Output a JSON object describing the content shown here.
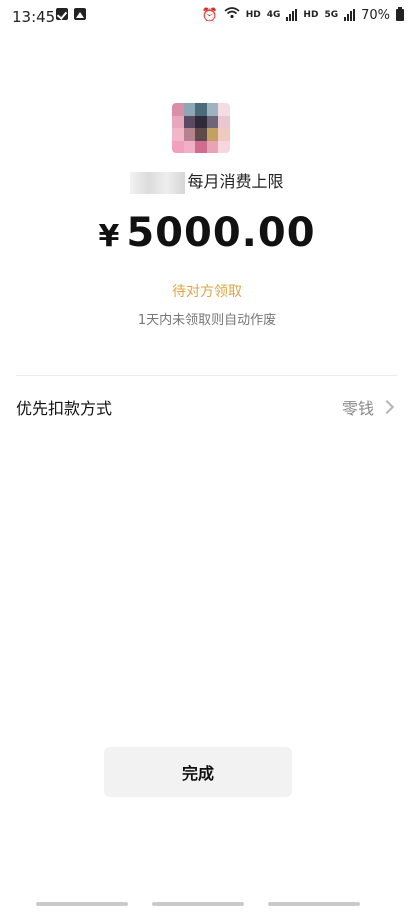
{
  "status_bar": {
    "time": "13:45",
    "hd1": "HD",
    "net1": "4G",
    "hd2": "HD",
    "net2": "5G",
    "battery": "70%",
    "icons": [
      "checkbox-icon",
      "photo-icon",
      "alarm-icon",
      "wifi-icon",
      "signal-icon",
      "battery-icon"
    ]
  },
  "transfer": {
    "title_suffix": "每月消费上限",
    "currency": "¥",
    "amount": "5000.00",
    "status": "待对方领取",
    "expire_note": "1天内未领取则自动作废"
  },
  "payment": {
    "label": "优先扣款方式",
    "value": "零钱"
  },
  "done_button": "完成",
  "colors": {
    "pending": "#e0a544",
    "button_bg": "#f2f2f2"
  }
}
